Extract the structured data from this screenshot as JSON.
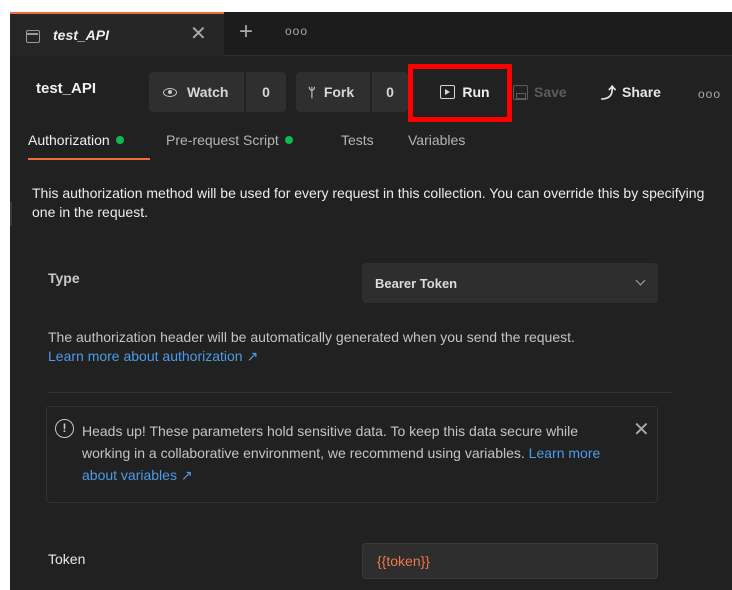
{
  "tab": {
    "title": "test_API",
    "close_glyph": "✕",
    "new_glyph": "+",
    "more_glyph": "ooo"
  },
  "header": {
    "collection_name": "test_API",
    "watch_label": "Watch",
    "watch_count": "0",
    "fork_label": "Fork",
    "fork_count": "0",
    "run_label": "Run",
    "save_label": "Save",
    "share_label": "Share",
    "more_glyph": "ooo"
  },
  "subtabs": [
    {
      "label": "Authorization",
      "active": true,
      "dot": true
    },
    {
      "label": "Pre-request Script",
      "active": false,
      "dot": true
    },
    {
      "label": "Tests",
      "active": false,
      "dot": false
    },
    {
      "label": "Variables",
      "active": false,
      "dot": false
    }
  ],
  "content": {
    "description": "This authorization method will be used for every request in this collection. You can override this by specifying one in the request.",
    "type_label": "Type",
    "type_value": "Bearer Token",
    "auth_info": "The authorization header will be automatically generated when you send the request.",
    "auth_link": "Learn more about authorization ↗",
    "alert_text": "Heads up! These parameters hold sensitive data. To keep this data secure while working in a collaborative environment, we recommend using variables. ",
    "alert_link": "Learn more about variables ↗",
    "token_label": "Token",
    "token_value": "{{token}}"
  },
  "colors": {
    "accent": "#f26b3a",
    "link": "#4a9be8",
    "status_dot": "#0cbb52",
    "highlight": "#ff0000",
    "variable": "#f0784a"
  },
  "icons": [
    "document-icon",
    "eye-icon",
    "fork-icon",
    "play-icon",
    "save-icon",
    "share-icon",
    "chevron-down-icon",
    "info-icon",
    "close-icon"
  ]
}
